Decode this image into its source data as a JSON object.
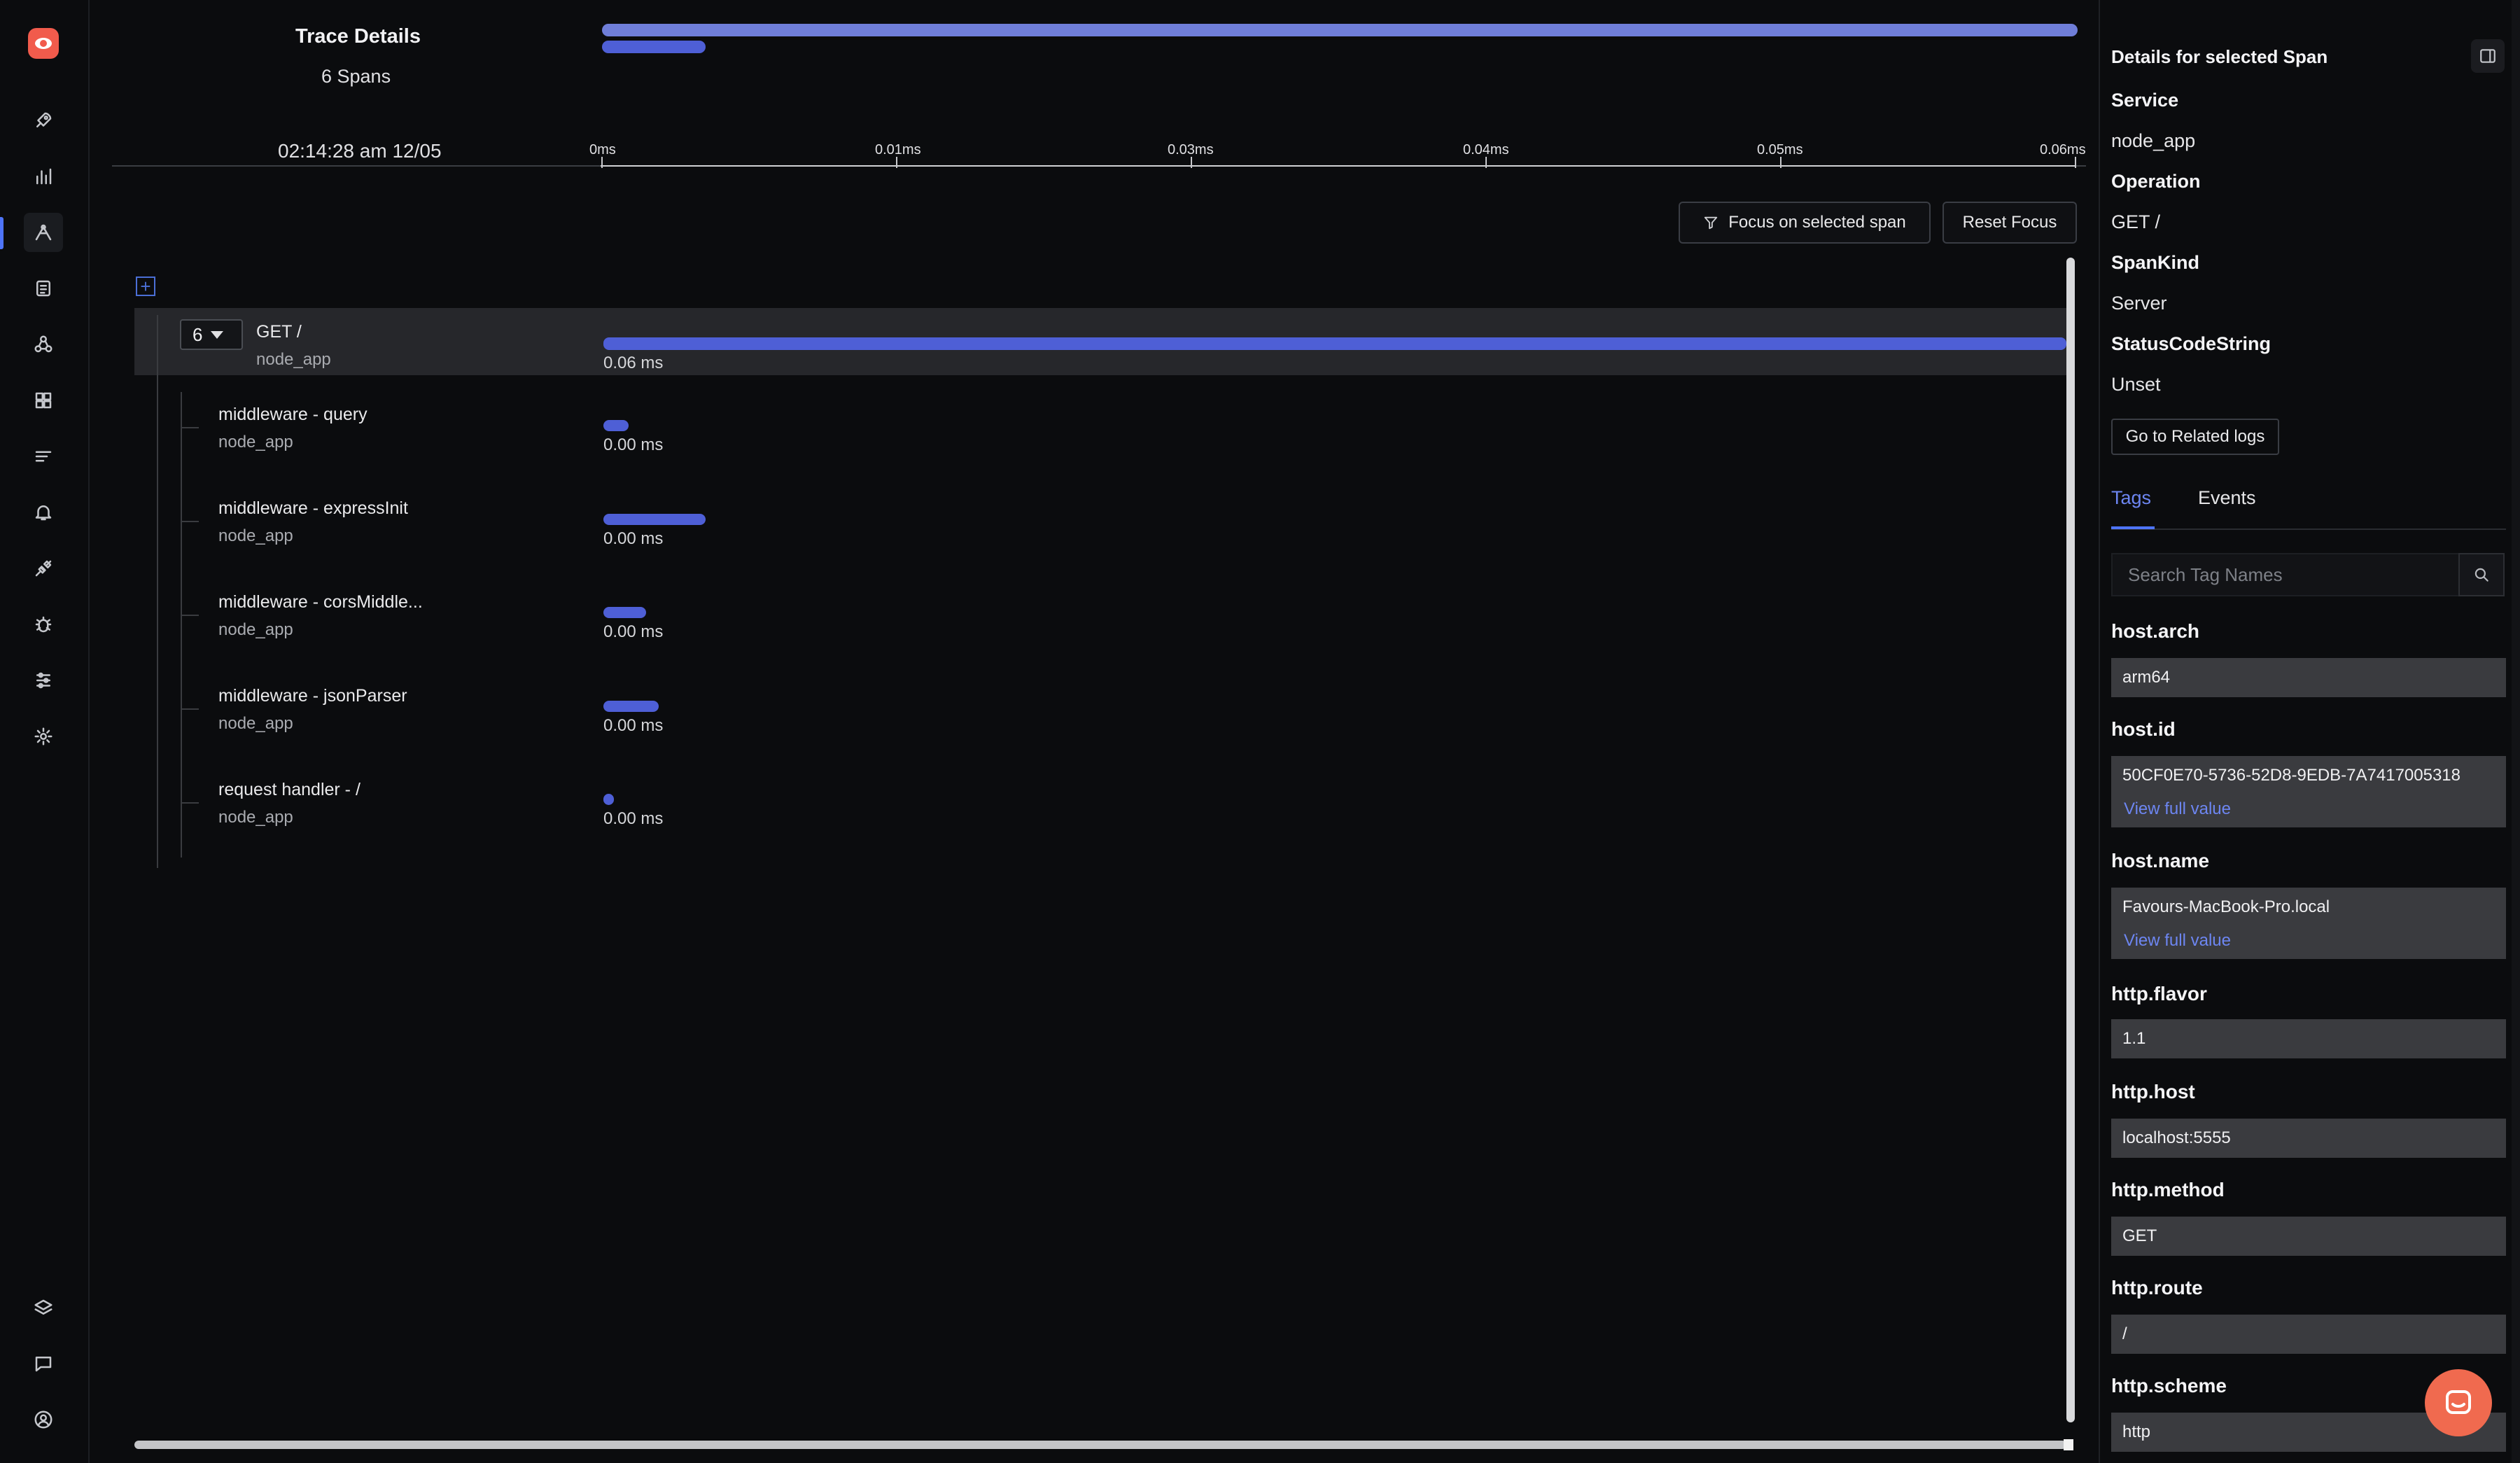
{
  "trace": {
    "title": "Trace Details",
    "span_count": "6 Spans",
    "timestamp": "02:14:28 am 12/05",
    "ticks": [
      "0ms",
      "0.01ms",
      "0.03ms",
      "0.04ms",
      "0.05ms",
      "0.06ms"
    ]
  },
  "actions": {
    "focus_label": "Focus on selected span",
    "reset_label": "Reset Focus"
  },
  "tree": {
    "root": {
      "count": "6",
      "name": "GET /",
      "service": "node_app",
      "duration": "0.06 ms",
      "bar_fraction": 1.0
    },
    "children": [
      {
        "name": "middleware - query",
        "service": "node_app",
        "duration": "0.00 ms",
        "bar_start": 0.0,
        "bar_fraction": 0.017
      },
      {
        "name": "middleware - expressInit",
        "service": "node_app",
        "duration": "0.00 ms",
        "bar_start": 0.0,
        "bar_fraction": 0.07
      },
      {
        "name": "middleware - corsMiddle...",
        "service": "node_app",
        "duration": "0.00 ms",
        "bar_start": 0.0,
        "bar_fraction": 0.029
      },
      {
        "name": "middleware - jsonParser",
        "service": "node_app",
        "duration": "0.00 ms",
        "bar_start": 0.0,
        "bar_fraction": 0.038
      },
      {
        "name": "request handler - /",
        "service": "node_app",
        "duration": "0.00 ms",
        "bar_start": 0.0,
        "bar_fraction": 0.007
      }
    ]
  },
  "panel": {
    "title": "Details for selected Span",
    "service_label": "Service",
    "service_value": "node_app",
    "operation_label": "Operation",
    "operation_value": "GET /",
    "spankind_label": "SpanKind",
    "spankind_value": "Server",
    "status_label": "StatusCodeString",
    "status_value": "Unset",
    "related_logs": "Go to Related logs",
    "tabs": [
      "Tags",
      "Events"
    ],
    "active_tab": "Tags",
    "search_placeholder": "Search Tag Names",
    "view_full": "View full value",
    "tags": [
      {
        "key": "host.arch",
        "value": "arm64"
      },
      {
        "key": "host.id",
        "value": "50CF0E70-5736-52D8-9EDB-7A7417005318",
        "truncated": true
      },
      {
        "key": "host.name",
        "value": "Favours-MacBook-Pro.local",
        "truncated": true
      },
      {
        "key": "http.flavor",
        "value": "1.1"
      },
      {
        "key": "http.host",
        "value": "localhost:5555"
      },
      {
        "key": "http.method",
        "value": "GET"
      },
      {
        "key": "http.route",
        "value": "/"
      },
      {
        "key": "http.scheme",
        "value": "http"
      }
    ]
  },
  "nav": {
    "items": [
      "rocket-icon",
      "bar-chart-icon",
      "traces-icon",
      "logs-icon",
      "service-map-icon",
      "dashboard-icon",
      "list-icon",
      "alerts-icon",
      "integrations-icon",
      "bug-icon",
      "pipelines-icon",
      "settings-icon",
      "layers-icon",
      "chat-icon",
      "user-icon"
    ],
    "active": "traces-icon"
  },
  "colors": {
    "accent": "#4e74f8",
    "span_bar": "#4e5fd6",
    "logo": "#f15b4c",
    "chat": "#f06a4f"
  }
}
